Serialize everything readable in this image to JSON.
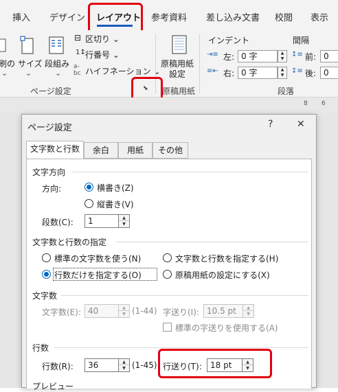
{
  "ribbon": {
    "tabs": [
      "挿入",
      "デザイン",
      "レイアウト",
      "参考資料",
      "差し込み文書",
      "校閲",
      "表示"
    ],
    "active_tab": "レイアウト",
    "page_setup": {
      "orientation_partial": "刷の",
      "size_label": "サイズ",
      "columns_label": "段組み",
      "breaks_label": "区切り",
      "line_numbers_label": "行番号",
      "hyphenation_label": "ハイフネーション",
      "group_label": "ページ設定"
    },
    "manuscript": {
      "button_label_1": "原稿用紙",
      "button_label_2": "設定",
      "group_label": "原稿用紙"
    },
    "indent": {
      "header": "インデント",
      "left_label": "左:",
      "left_value": "0 字",
      "right_label": "右:",
      "right_value": "0 字"
    },
    "spacing": {
      "header": "間隔",
      "before_label": "前:",
      "after_label": "後:",
      "before_value": "0",
      "after_value": "0"
    },
    "paragraph_group_label": "段落",
    "ruler_numbers": [
      "8",
      "6"
    ]
  },
  "dialog": {
    "title": "ページ設定",
    "help_button": "?",
    "close_button": "✕",
    "tabs": [
      "文字数と行数",
      "余白",
      "用紙",
      "その他"
    ],
    "active_tab": "文字数と行数",
    "text_direction": {
      "section_title": "文字方向",
      "direction_label": "方向:",
      "horizontal_label": "横書き(Z)",
      "vertical_label": "縦書き(V)",
      "columns_label": "段数(C):",
      "columns_value": "1"
    },
    "grid": {
      "section_title": "文字数と行数の指定",
      "opt_standard": "標準の文字数を使う(N)",
      "opt_chars_lines": "文字数と行数を指定する(H)",
      "opt_lines_only": "行数だけを指定する(O)",
      "opt_manuscript": "原稿用紙の設定にする(X)"
    },
    "chars": {
      "section_title": "文字数",
      "count_label": "文字数(E):",
      "count_value": "40",
      "count_range": "(1-44)",
      "pitch_label": "字送り(I):",
      "pitch_value": "10.5 pt",
      "use_standard_label": "標準の字送りを使用する(A)"
    },
    "lines": {
      "section_title": "行数",
      "count_label": "行数(R):",
      "count_value": "36",
      "count_range": "(1-45)",
      "pitch_label": "行送り(T):",
      "pitch_value": "18 pt"
    },
    "preview_title": "プレビュー"
  }
}
